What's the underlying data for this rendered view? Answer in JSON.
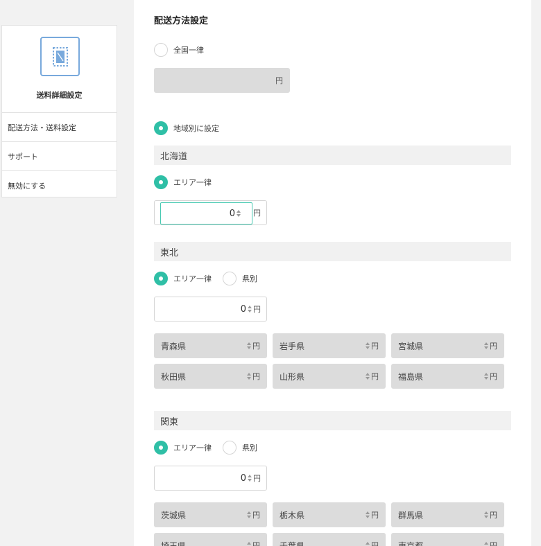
{
  "sidebar": {
    "title": "送料詳細設定",
    "icon": "stamp-icon",
    "items": [
      {
        "label": "配送方法・送料設定"
      },
      {
        "label": "サポート"
      },
      {
        "label": "無効にする"
      }
    ]
  },
  "main": {
    "section_title": "配送方法設定",
    "option_flat": "全国一律",
    "flat_yen": "円",
    "option_by_region": "地域別に設定",
    "yen": "円",
    "regions": [
      {
        "name": "北海道",
        "mode_uniform": "エリア一律",
        "value": "0"
      },
      {
        "name": "東北",
        "mode_uniform": "エリア一律",
        "mode_by_pref": "県別",
        "value": "0",
        "prefectures": [
          "青森県",
          "岩手県",
          "宮城県",
          "秋田県",
          "山形県",
          "福島県"
        ]
      },
      {
        "name": "関東",
        "mode_uniform": "エリア一律",
        "mode_by_pref": "県別",
        "value": "0",
        "prefectures": [
          "茨城県",
          "栃木県",
          "群馬県",
          "埼玉県",
          "千葉県",
          "東京都"
        ]
      }
    ]
  },
  "colors": {
    "accent": "#2fbfa6",
    "icon_blue": "#78a9dc",
    "field_gray": "#dcdcdc"
  }
}
